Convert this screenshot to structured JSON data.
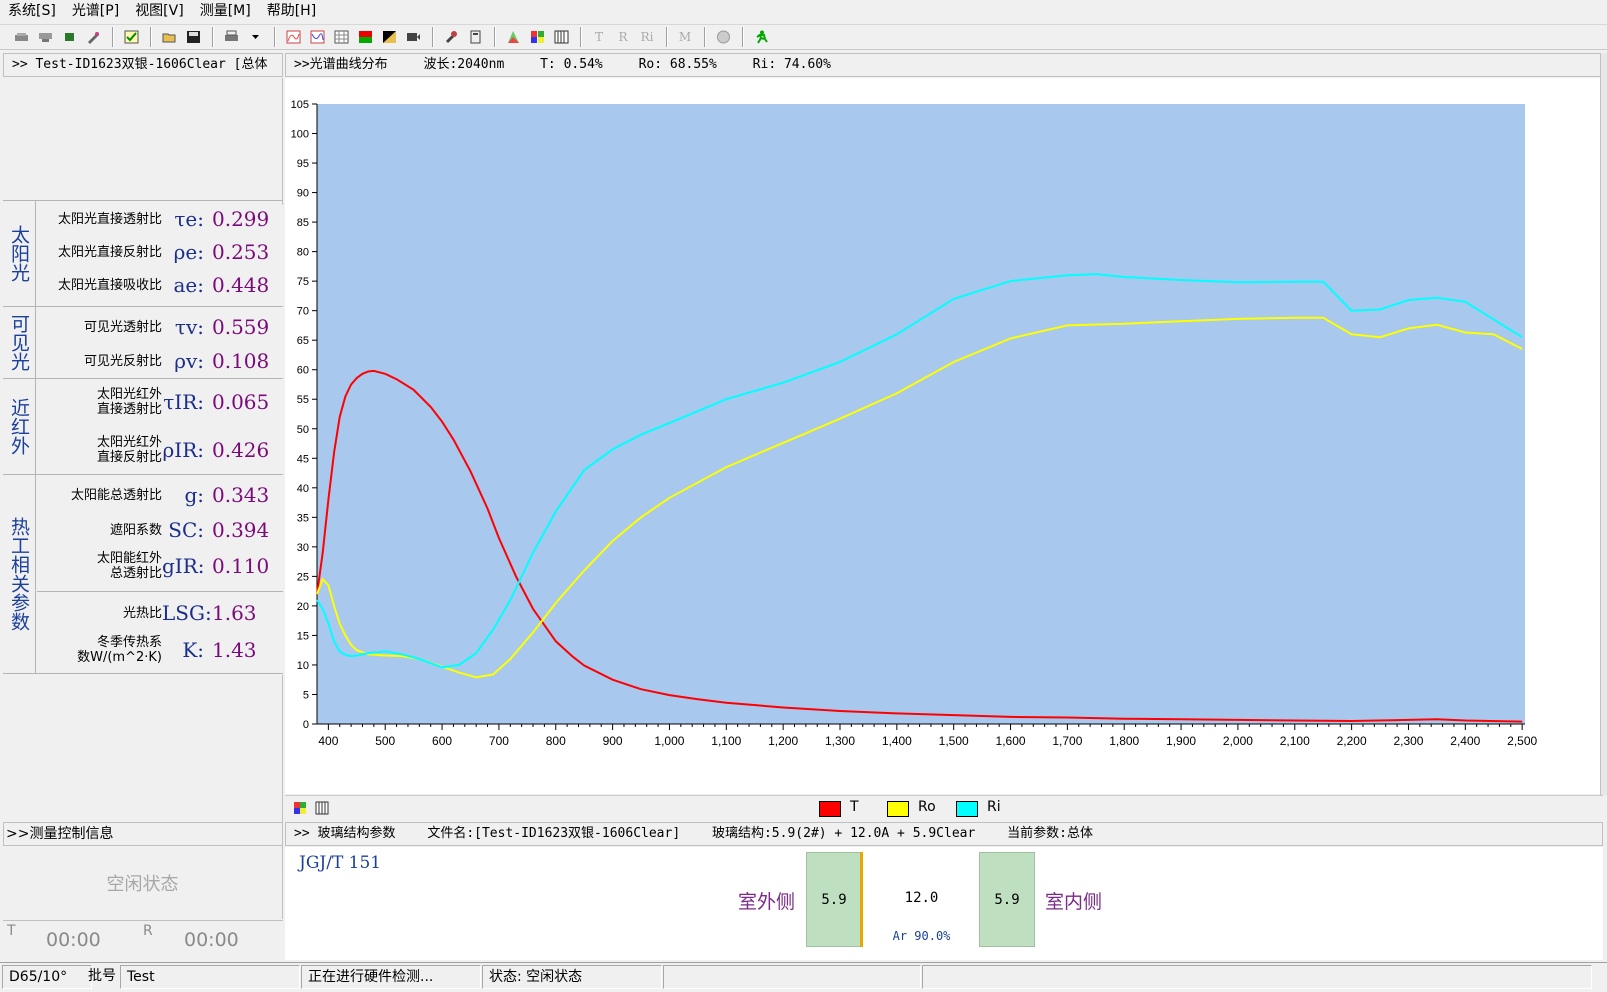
{
  "menu": [
    {
      "label": "系统[S]"
    },
    {
      "label": "光谱[P]"
    },
    {
      "label": "视图[V]"
    },
    {
      "label": "测量[M]"
    },
    {
      "label": "帮助[H]"
    }
  ],
  "toolbar": {
    "icons": [
      "device-icon",
      "device2-icon",
      "small-icon",
      "tools-icon",
      "check-icon",
      "open-folder-icon",
      "save-icon",
      "print-icon",
      "print-dropdown-icon",
      "spectrum-icon",
      "spectrum2-icon",
      "table-icon",
      "color-icon",
      "black-icon",
      "film-icon",
      "wrench-icon",
      "calculator-icon",
      "color-triangle-icon",
      "grid-icon",
      "list-icon",
      "T-icon",
      "R-icon",
      "Ri-icon",
      "M-icon",
      "help-icon",
      "run-icon"
    ],
    "text_glyphs": {
      "T-icon": "T",
      "R-icon": "R",
      "Ri-icon": "Ri",
      "M-icon": "M"
    }
  },
  "left_header": ">> Test-ID1623双银-1606Clear  [总体",
  "solar": {
    "group_label": "太阳光",
    "rows": [
      {
        "name": "太阳光直接透射比",
        "symbol": "τe:",
        "value": "0.299"
      },
      {
        "name": "太阳光直接反射比",
        "symbol": "ρe:",
        "value": "0.253"
      },
      {
        "name": "太阳光直接吸收比",
        "symbol": "ae:",
        "value": "0.448"
      }
    ]
  },
  "visible": {
    "group_label": "可见光",
    "rows": [
      {
        "name": "可见光透射比",
        "symbol": "τv:",
        "value": "0.559"
      },
      {
        "name": "可见光反射比",
        "symbol": "ρv:",
        "value": "0.108"
      }
    ]
  },
  "nir": {
    "group_label": "近红外",
    "rows": [
      {
        "name1": "太阳光红外",
        "name2": "直接透射比",
        "symbol": "τIR:",
        "value": "0.065"
      },
      {
        "name1": "太阳光红外",
        "name2": "直接反射比",
        "symbol": "ρIR:",
        "value": "0.426"
      }
    ]
  },
  "thermal": {
    "group_label": "热工相关参数",
    "rows": [
      {
        "name": "太阳能总透射比",
        "symbol": "g:",
        "value": "0.343"
      },
      {
        "name": "遮阳系数",
        "symbol": "SC:",
        "value": "0.394"
      },
      {
        "name1": "太阳能红外",
        "name2": "总透射比",
        "symbol": "gIR:",
        "value": "0.110"
      },
      {
        "name": "光热比",
        "symbol": "LSG:",
        "value": "1.63"
      },
      {
        "name1": "冬季传热系",
        "name2": "数W/(m^2·K)",
        "symbol": "K:",
        "value": "1.43"
      }
    ]
  },
  "measure": {
    "header": ">>测量控制信息",
    "status": "空闲状态",
    "t_label": "T",
    "t_time": "00:00",
    "r_label": "R",
    "r_time": "00:00"
  },
  "chart_header": {
    "title": ">>光谱曲线分布",
    "wavelength": "波长:2040nm",
    "t": "T: 0.54%",
    "ro": "Ro: 68.55%",
    "ri": "Ri: 74.60%"
  },
  "chart_data": {
    "type": "line",
    "xlabel": "",
    "ylabel": "",
    "xlim": [
      380,
      2505
    ],
    "ylim": [
      0,
      105
    ],
    "x_ticks": [
      400,
      500,
      600,
      700,
      800,
      900,
      1000,
      1100,
      1200,
      1300,
      1400,
      1500,
      1600,
      1700,
      1800,
      1900,
      2000,
      2100,
      2200,
      2300,
      2400,
      2500
    ],
    "x_tick_labels": [
      "400",
      "500",
      "600",
      "700",
      "800",
      "900",
      "1,000",
      "1,100",
      "1,200",
      "1,300",
      "1,400",
      "1,500",
      "1,600",
      "1,700",
      "1,800",
      "1,900",
      "2,000",
      "2,100",
      "2,200",
      "2,300",
      "2,400",
      "2,500"
    ],
    "y_ticks": [
      0,
      5,
      10,
      15,
      20,
      25,
      30,
      35,
      40,
      45,
      50,
      55,
      60,
      65,
      70,
      75,
      80,
      85,
      90,
      95,
      100,
      105
    ],
    "grid": false,
    "plot_bg": "#a8c8ee",
    "series": [
      {
        "name": "T",
        "color": "#ff0000",
        "x": [
          380,
          390,
          400,
          410,
          420,
          430,
          440,
          450,
          460,
          470,
          480,
          500,
          520,
          550,
          580,
          600,
          620,
          650,
          680,
          700,
          730,
          760,
          800,
          830,
          850,
          900,
          950,
          1000,
          1050,
          1100,
          1200,
          1300,
          1400,
          1500,
          1600,
          1700,
          1800,
          1900,
          2000,
          2100,
          2200,
          2300,
          2350,
          2400,
          2500
        ],
        "y": [
          22,
          29,
          38,
          46,
          52,
          55.5,
          57.5,
          58.6,
          59.3,
          59.7,
          59.8,
          59.3,
          58.4,
          56.6,
          53.7,
          51.2,
          48.2,
          42.8,
          36.5,
          31.5,
          25,
          19.5,
          14,
          11.4,
          9.9,
          7.5,
          5.9,
          4.9,
          4.2,
          3.6,
          2.8,
          2.2,
          1.8,
          1.5,
          1.2,
          1.1,
          0.9,
          0.8,
          0.7,
          0.6,
          0.5,
          0.7,
          0.8,
          0.6,
          0.4
        ]
      },
      {
        "name": "Ro",
        "color": "#ffff00",
        "x": [
          380,
          390,
          400,
          410,
          420,
          430,
          440,
          450,
          470,
          500,
          530,
          560,
          600,
          630,
          660,
          690,
          720,
          760,
          800,
          850,
          900,
          950,
          1000,
          1100,
          1200,
          1300,
          1400,
          1500,
          1600,
          1700,
          1800,
          1900,
          2000,
          2100,
          2150,
          2200,
          2250,
          2300,
          2350,
          2400,
          2450,
          2500
        ],
        "y": [
          22,
          24.5,
          23.5,
          20,
          17,
          15,
          13.4,
          12.5,
          11.8,
          11.6,
          11.5,
          11,
          9.7,
          8.7,
          7.9,
          8.4,
          11,
          15.5,
          20.5,
          26,
          31,
          35,
          38.3,
          43.5,
          47.6,
          51.7,
          56,
          61.3,
          65.3,
          67.5,
          67.8,
          68.2,
          68.6,
          68.8,
          68.8,
          66,
          65.5,
          67,
          67.6,
          66.3,
          66,
          63.5
        ]
      },
      {
        "name": "Ri",
        "color": "#00ffff",
        "x": [
          380,
          390,
          400,
          410,
          420,
          430,
          440,
          450,
          470,
          500,
          530,
          560,
          600,
          630,
          660,
          690,
          720,
          760,
          800,
          850,
          900,
          950,
          1000,
          1100,
          1200,
          1300,
          1400,
          1500,
          1600,
          1700,
          1750,
          1800,
          1900,
          2000,
          2100,
          2150,
          2200,
          2250,
          2300,
          2350,
          2400,
          2500
        ],
        "y": [
          21,
          19.5,
          17,
          14,
          12.3,
          11.7,
          11.5,
          11.6,
          12,
          12.3,
          11.8,
          11,
          9.6,
          10,
          12,
          16,
          21,
          29,
          36,
          43,
          46.5,
          49,
          51,
          55,
          57.8,
          61.3,
          66,
          72,
          75,
          76,
          76.2,
          75.7,
          75.2,
          74.8,
          74.9,
          74.9,
          70,
          70.2,
          71.8,
          72.2,
          71.5,
          65.5
        ]
      }
    ]
  },
  "legend": {
    "icons": [
      "palette-icon",
      "bars-icon"
    ],
    "items": [
      {
        "label": "T",
        "color": "#ff0000"
      },
      {
        "label": "Ro",
        "color": "#ffff00"
      },
      {
        "label": "Ri",
        "color": "#00ffff"
      }
    ]
  },
  "glass_header": {
    "title": ">> 玻璃结构参数",
    "filename": "文件名:[Test-ID1623双银-1606Clear]",
    "structure": "玻璃结构:5.9(2#) + 12.0A + 5.9Clear",
    "current": "当前参数:总体"
  },
  "glass": {
    "standard": "JGJ/T 151",
    "outside": "室外侧",
    "inside": "室内侧",
    "pane1": "5.9",
    "gap": "12.0",
    "gas": "Ar 90.0%",
    "pane2": "5.9",
    "pane_color": "#bfe0c0",
    "coating_color": "#e8a800"
  },
  "statusbar": {
    "illuminant": "D65/10°",
    "batch_label": "批号",
    "batch": "Test",
    "message": "正在进行硬件检测...",
    "state": "状态: 空闲状态"
  }
}
